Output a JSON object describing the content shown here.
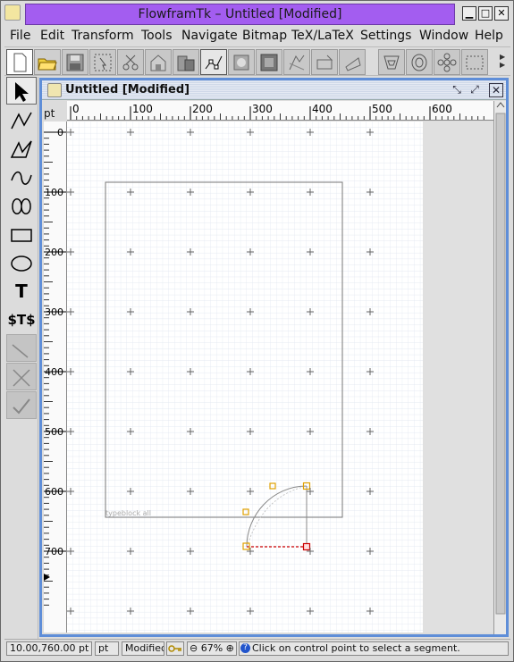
{
  "window": {
    "title": "FlowframTk – Untitled [Modified]",
    "controls": [
      "minimize",
      "maximize",
      "close"
    ]
  },
  "menu": [
    "File",
    "Edit",
    "Transform",
    "Tools",
    "Navigate",
    "Bitmap",
    "TeX/LaTeX",
    "Settings",
    "Window",
    "Help"
  ],
  "toolbar": {
    "buttons": [
      "new-file",
      "open-folder",
      "save",
      "select-region",
      "cut",
      "copy",
      "paste",
      "select-all",
      "edit-path",
      "convert",
      "group",
      "ungroup",
      "reflect",
      "rotate",
      "scale",
      "shear",
      "pattern",
      "distort",
      "flower",
      "spiral",
      "grid-toggle",
      "more"
    ]
  },
  "palette": [
    "select-arrow",
    "open-line",
    "closed-line",
    "open-curve",
    "closed-curve",
    "rectangle",
    "ellipse",
    "text",
    "math-text",
    "gap-tool",
    "abandon",
    "finish"
  ],
  "palette_text": {
    "text_tool": "T",
    "math_tool": "$T$"
  },
  "document": {
    "title": "Untitled [Modified]",
    "unit_label": "pt",
    "h_ticks": [
      "0",
      "100",
      "200",
      "300",
      "400",
      "500",
      "600"
    ],
    "v_ticks": [
      "0",
      "100",
      "200",
      "300",
      "400",
      "500",
      "600",
      "700"
    ],
    "typeblock_label": "typeblock all"
  },
  "status": {
    "coords": "10.00,760.00 pt",
    "unit": "pt",
    "modified": "Modified",
    "zoom": "67%",
    "hint": "Click on control point to select a segment."
  },
  "colors": {
    "title_bar": "#a35df0",
    "frame_border": "#5f8ed8",
    "control_point": "#e0a000",
    "selected_segment": "#cc0000"
  }
}
